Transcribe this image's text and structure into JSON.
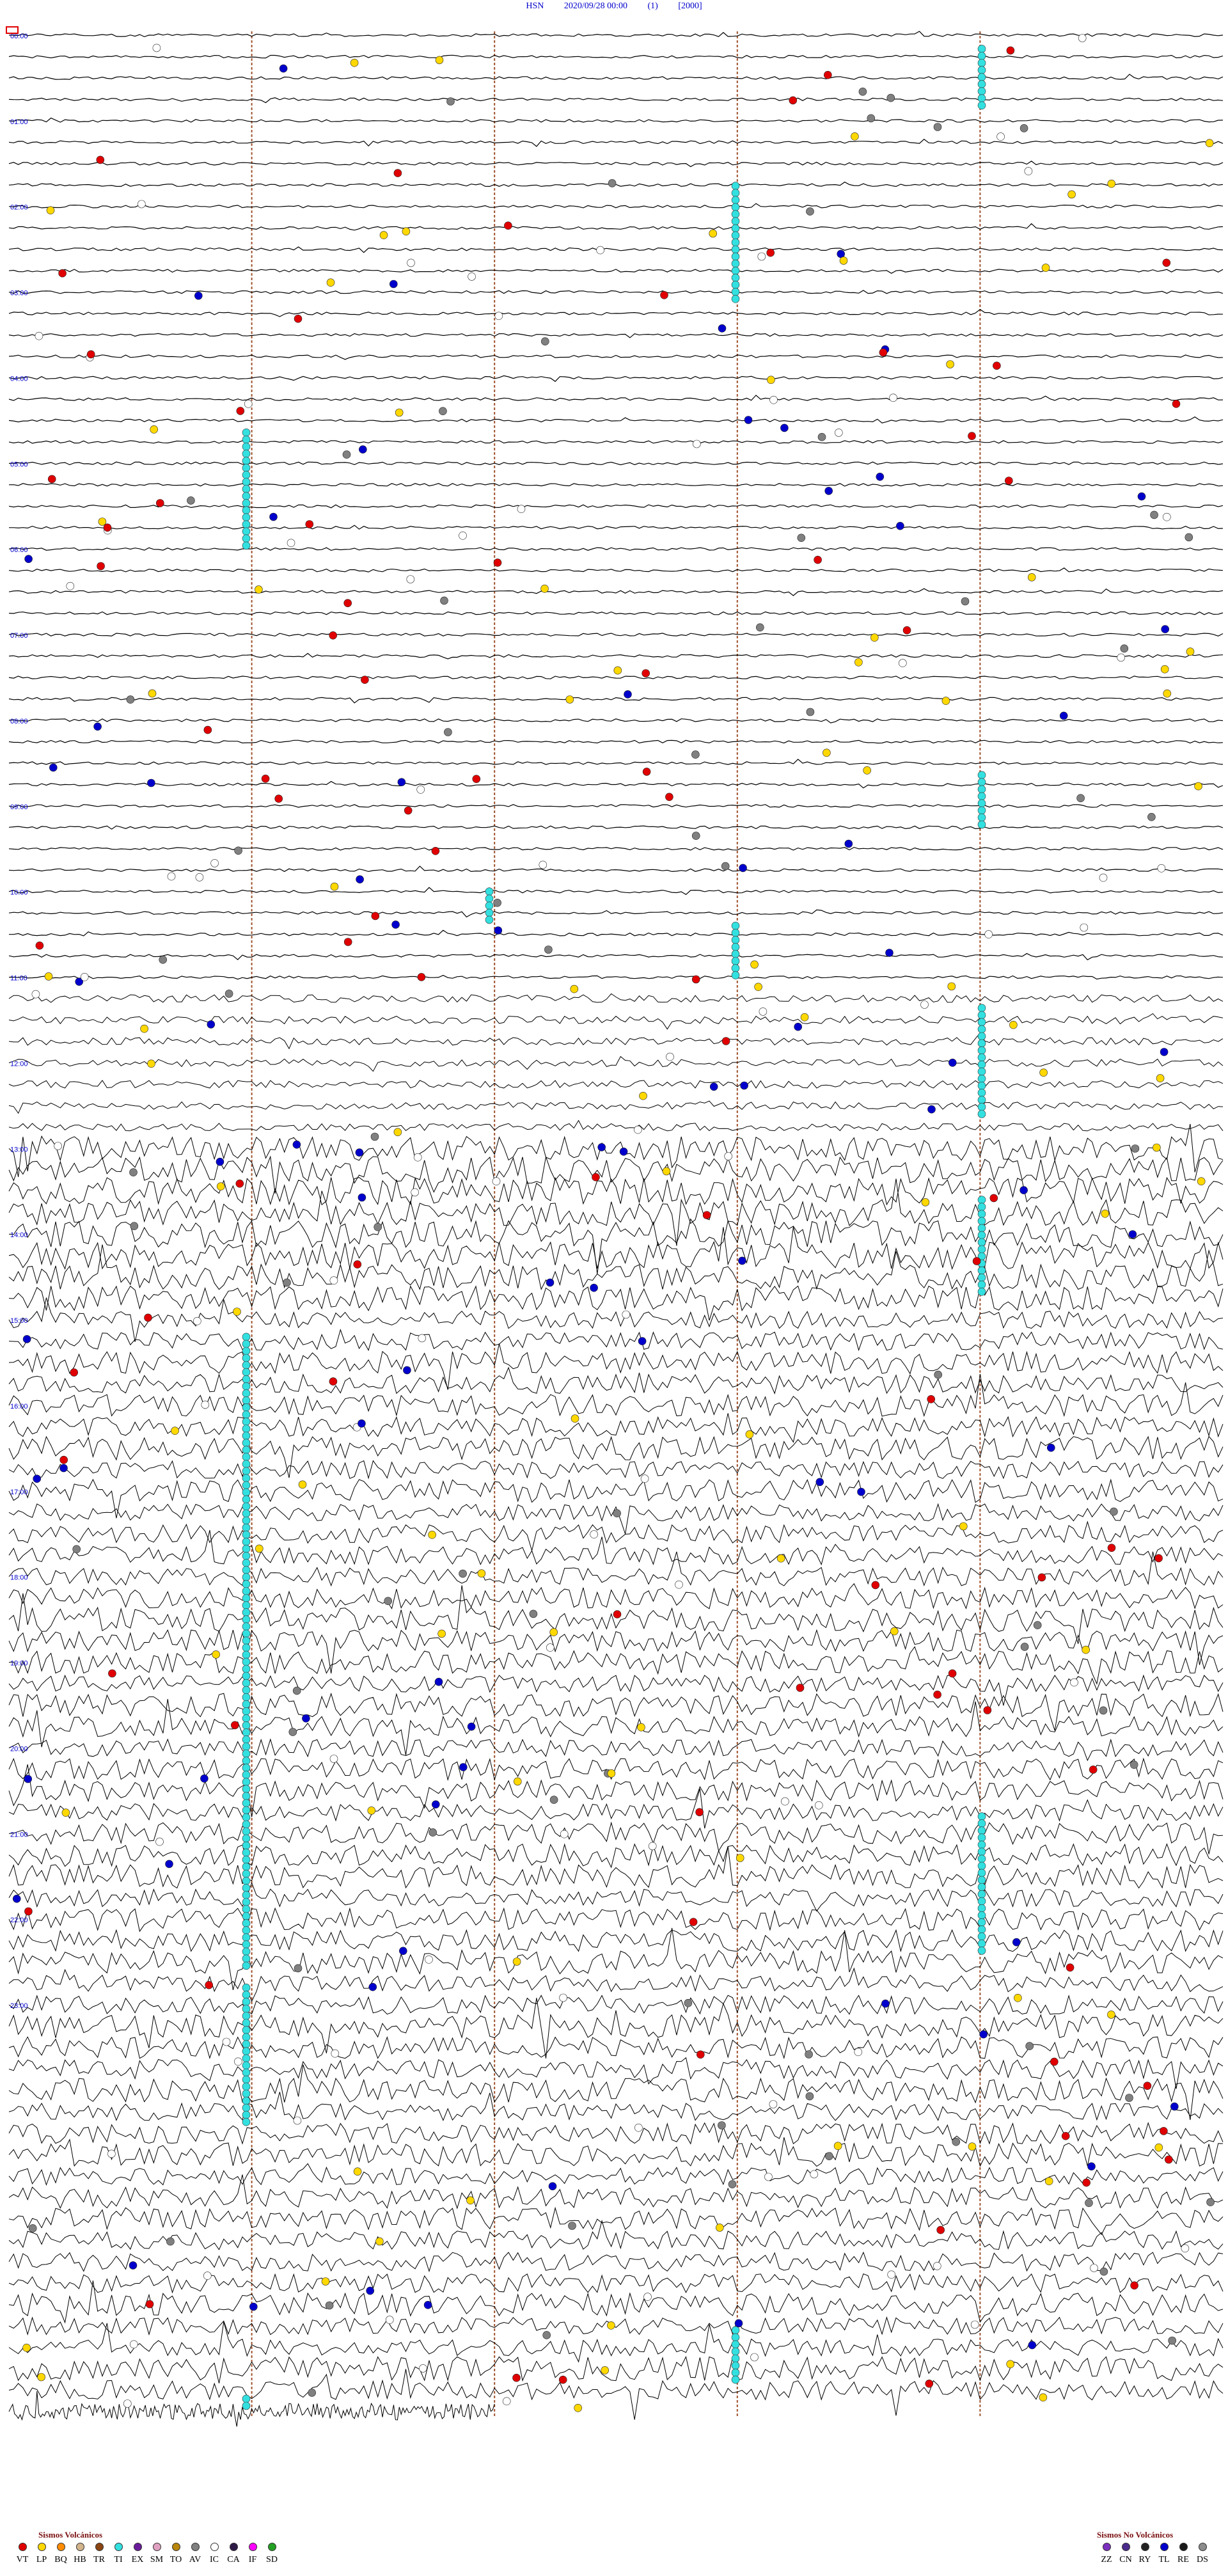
{
  "header": {
    "station": "HSN",
    "datetime": "2020/09/28 00:00",
    "channel": "(1)",
    "gain": "[2000]"
  },
  "colors": {
    "header_text": "#0000cc",
    "trace": "#000000",
    "hour_marker": "#a0522d",
    "VT": "#e00000",
    "LP": "#ffd800",
    "BQ": "#ff8c00",
    "HB": "#d2b48c",
    "TR": "#8b4513",
    "TI": "#33e0e0",
    "EX": "#6a1b9a",
    "SM": "#e0a0c0",
    "TO": "#b8860b",
    "AV": "#808080",
    "IC": "#ffffff",
    "CA": "#2e1a47",
    "IF": "#ff00ff",
    "SD": "#22a022",
    "ZZ": "#7b2fbe",
    "CN": "#4a2a8a",
    "RY": "#222222",
    "TL": "#0000cc",
    "RE": "#1a1a1a",
    "DS": "#8c8c8c"
  },
  "chart_data": {
    "type": "helicorder",
    "station": "HSN",
    "date": "2020/09/28",
    "trace_count": 112,
    "minutes_per_trace": 15,
    "hour_labels": [
      "00:00",
      "01:00",
      "02:00",
      "03:00",
      "04:00",
      "05:00",
      "06:00",
      "07:00",
      "08:00",
      "09:00",
      "10:00",
      "11:00",
      "12:00",
      "13:00",
      "14:00",
      "15:00",
      "16:00",
      "17:00",
      "18:00",
      "19:00",
      "20:00",
      "21:00",
      "22:00",
      "23:00"
    ],
    "legend_volcanic": {
      "title": "Sismos Volcánicos",
      "codes": [
        "VT",
        "LP",
        "BQ",
        "HB",
        "TR",
        "TI",
        "EX",
        "SM",
        "TO",
        "AV",
        "IC",
        "CA",
        "IF",
        "SD"
      ]
    },
    "legend_non_volcanic": {
      "title": "Sismos No Volcánicos",
      "codes": [
        "ZZ",
        "CN",
        "RY",
        "TL",
        "RE",
        "DS"
      ]
    }
  }
}
